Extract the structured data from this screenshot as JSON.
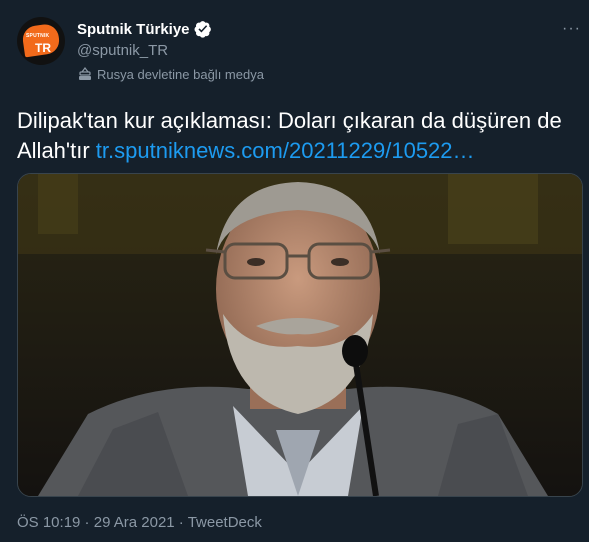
{
  "account": {
    "display_name": "Sputnik Türkiye",
    "handle": "@sputnik_TR",
    "avatar_text": "TR",
    "avatar_mini_text": "SPUTNIK",
    "more_label": "···"
  },
  "label": {
    "text": "Rusya devletine bağlı medya"
  },
  "tweet": {
    "text": "Dilipak'tan kur açıklaması: Doları çıkaran da düşüren de Allah'tır ",
    "link": "tr.sputniknews.com/20211229/10522…"
  },
  "meta": {
    "time": "ÖS 10:19",
    "separator1": " · ",
    "date": "29 Ara 2021",
    "separator2": " · ",
    "source": "TweetDeck"
  },
  "colors": {
    "background": "#15202b",
    "link": "#1d9bf0",
    "secondary_text": "#8b98a5",
    "avatar_brand": "#f26a1b"
  }
}
